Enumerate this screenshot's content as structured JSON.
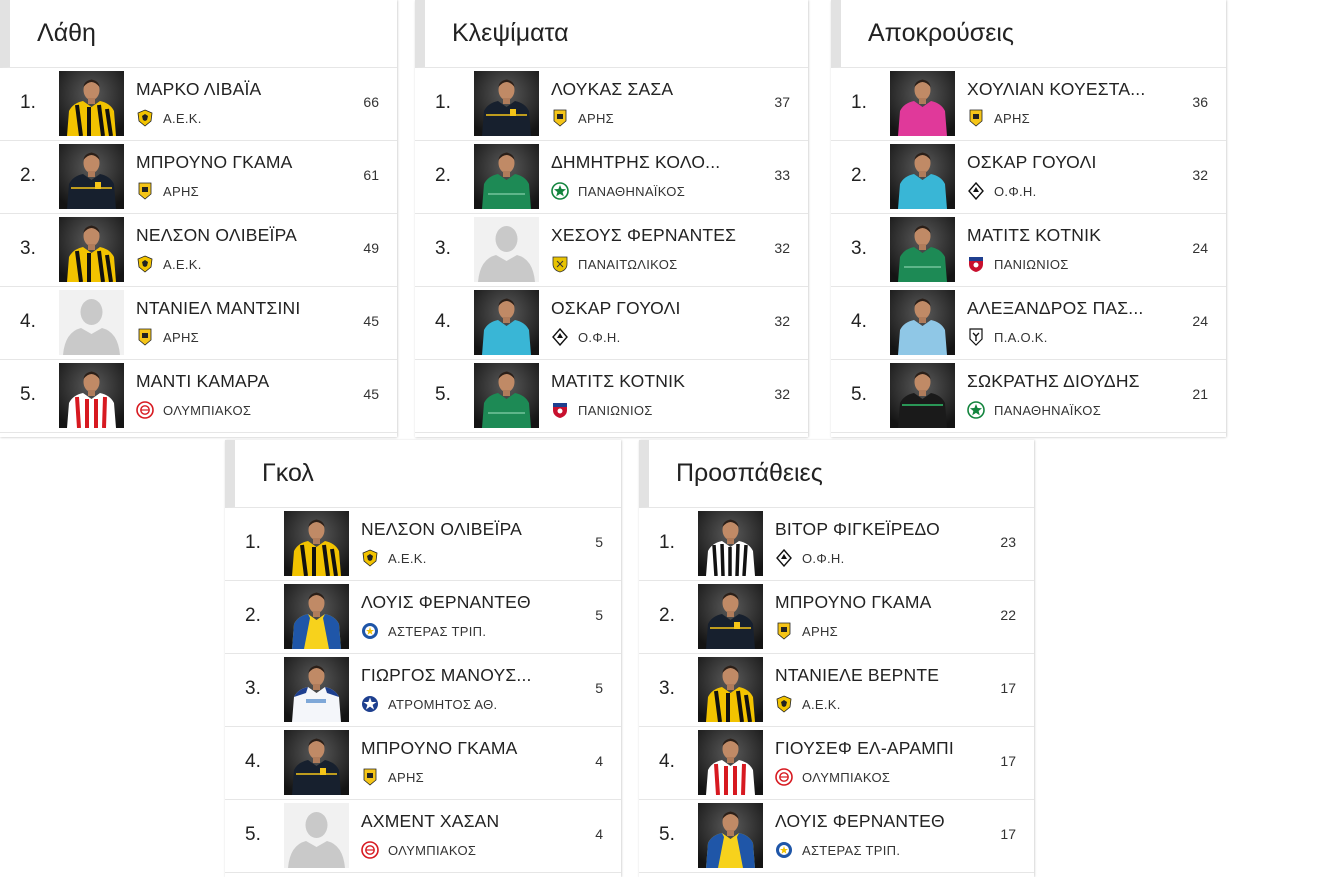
{
  "colors": {
    "header_bar": "#e2e2e2",
    "divider": "#e6e6e6",
    "aek": "#f2c300",
    "aris": "#f5c518",
    "olympiacos": "#d71920",
    "panathinaikos": "#12843d",
    "paniliakos": "#e8c300",
    "panionios": "#c8102e",
    "asteras": "#1f56a8",
    "atromitos": "#1d3f8f",
    "paok": "#111111",
    "ofi": "#111111"
  },
  "panels": [
    {
      "title": "Λάθη",
      "rows": [
        {
          "rank": "1.",
          "name": "ΜΑΡΚΟ ΛΙΒΑΪΑ",
          "team": "Α.Ε.Κ.",
          "crest": "aek-crest-icon",
          "photo": "aek",
          "value": "66"
        },
        {
          "rank": "2.",
          "name": "ΜΠΡΟΥΝΟ ΓΚΑΜΑ",
          "team": "ΑΡΗΣ",
          "crest": "aris-crest-icon",
          "photo": "aris",
          "value": "61"
        },
        {
          "rank": "3.",
          "name": "ΝΕΛΣΟΝ ΟΛΙΒΕΪΡΑ",
          "team": "Α.Ε.Κ.",
          "crest": "aek-crest-icon",
          "photo": "aek",
          "value": "49"
        },
        {
          "rank": "4.",
          "name": "ΝΤΑΝΙΕΛ ΜΑΝΤΣΙΝΙ",
          "team": "ΑΡΗΣ",
          "crest": "aris-crest-icon",
          "photo": "placeholder",
          "value": "45"
        },
        {
          "rank": "5.",
          "name": "ΜΑΝΤΙ ΚΑΜΑΡΑ",
          "team": "ΟΛΥΜΠΙΑΚΟΣ",
          "crest": "olympiacos-crest-icon",
          "photo": "olympiacos",
          "value": "45"
        }
      ]
    },
    {
      "title": "Κλεψίματα",
      "rows": [
        {
          "rank": "1.",
          "name": "ΛΟΥΚΑΣ ΣΑΣΑ",
          "team": "ΑΡΗΣ",
          "crest": "aris-crest-icon",
          "photo": "aris",
          "value": "37"
        },
        {
          "rank": "2.",
          "name": "ΔΗΜΗΤΡΗΣ ΚΟΛΟ...",
          "team": "ΠΑΝΑΘΗΝΑΪΚΟΣ",
          "crest": "panathinaikos-crest-icon",
          "photo": "pao",
          "value": "33"
        },
        {
          "rank": "3.",
          "name": "ΧΕΣΟΥΣ ΦΕΡΝΑΝΤΕΣ",
          "team": "ΠΑΝΑΙΤΩΛΙΚΟΣ",
          "crest": "panaitolikos-crest-icon",
          "photo": "placeholder",
          "value": "32"
        },
        {
          "rank": "4.",
          "name": "ΟΣΚΑΡ ΓΟΥΟΛΙ",
          "team": "Ο.Φ.Η.",
          "crest": "ofi-crest-icon",
          "photo": "gk-cyan",
          "value": "32"
        },
        {
          "rank": "5.",
          "name": "ΜΑΤΙΤΣ ΚΟΤΝΙΚ",
          "team": "ΠΑΝΙΩΝΙΟΣ",
          "crest": "panionios-crest-icon",
          "photo": "gk-green",
          "value": "32"
        }
      ]
    },
    {
      "title": "Αποκρούσεις",
      "rows": [
        {
          "rank": "1.",
          "name": "ΧΟΥΛΙΑΝ ΚΟΥΕΣΤΑ...",
          "team": "ΑΡΗΣ",
          "crest": "aris-crest-icon",
          "photo": "gk-pink",
          "value": "36"
        },
        {
          "rank": "2.",
          "name": "ΟΣΚΑΡ ΓΟΥΟΛΙ",
          "team": "Ο.Φ.Η.",
          "crest": "ofi-crest-icon",
          "photo": "gk-cyan",
          "value": "32"
        },
        {
          "rank": "3.",
          "name": "ΜΑΤΙΤΣ ΚΟΤΝΙΚ",
          "team": "ΠΑΝΙΩΝΙΟΣ",
          "crest": "panionios-crest-icon",
          "photo": "gk-green",
          "value": "24"
        },
        {
          "rank": "4.",
          "name": "ΑΛΕΞΑΝΔΡΟΣ ΠΑΣ...",
          "team": "Π.Α.Ο.Κ.",
          "crest": "paok-crest-icon",
          "photo": "gk-sky",
          "value": "24"
        },
        {
          "rank": "5.",
          "name": "ΣΩΚΡΑΤΗΣ ΔΙΟΥΔΗΣ",
          "team": "ΠΑΝΑΘΗΝΑΪΚΟΣ",
          "crest": "panathinaikos-crest-icon",
          "photo": "gk-black",
          "value": "21"
        }
      ]
    },
    {
      "title": "Γκολ",
      "rows": [
        {
          "rank": "1.",
          "name": "ΝΕΛΣΟΝ ΟΛΙΒΕΪΡΑ",
          "team": "Α.Ε.Κ.",
          "crest": "aek-crest-icon",
          "photo": "aek",
          "value": "5"
        },
        {
          "rank": "2.",
          "name": "ΛΟΥΙΣ ΦΕΡΝΑΝΤΕΘ",
          "team": "ΑΣΤΕΡΑΣ ΤΡΙΠ.",
          "crest": "asteras-crest-icon",
          "photo": "asteras",
          "value": "5"
        },
        {
          "rank": "3.",
          "name": "ΓΙΩΡΓΟΣ ΜΑΝΟΥΣ...",
          "team": "ΑΤΡΟΜΗΤΟΣ ΑΘ.",
          "crest": "atromitos-crest-icon",
          "photo": "atromitos",
          "value": "5"
        },
        {
          "rank": "4.",
          "name": "ΜΠΡΟΥΝΟ ΓΚΑΜΑ",
          "team": "ΑΡΗΣ",
          "crest": "aris-crest-icon",
          "photo": "aris",
          "value": "4"
        },
        {
          "rank": "5.",
          "name": "ΑΧΜΕΝΤ ΧΑΣΑΝ",
          "team": "ΟΛΥΜΠΙΑΚΟΣ",
          "crest": "olympiacos-crest-icon",
          "photo": "placeholder",
          "value": "4"
        }
      ]
    },
    {
      "title": "Προσπάθειες",
      "rows": [
        {
          "rank": "1.",
          "name": "ΒΙΤΟΡ ΦΙΓΚΕΪΡΕΔΟ",
          "team": "Ο.Φ.Η.",
          "crest": "ofi-crest-icon",
          "photo": "ofi",
          "value": "23"
        },
        {
          "rank": "2.",
          "name": "ΜΠΡΟΥΝΟ ΓΚΑΜΑ",
          "team": "ΑΡΗΣ",
          "crest": "aris-crest-icon",
          "photo": "aris",
          "value": "22"
        },
        {
          "rank": "3.",
          "name": "ΝΤΑΝΙΕΛΕ ΒΕΡΝΤΕ",
          "team": "Α.Ε.Κ.",
          "crest": "aek-crest-icon",
          "photo": "aek",
          "value": "17"
        },
        {
          "rank": "4.",
          "name": "ΓΙΟΥΣΕΦ ΕΛ-ΑΡΑΜΠΙ",
          "team": "ΟΛΥΜΠΙΑΚΟΣ",
          "crest": "olympiacos-crest-icon",
          "photo": "olympiacos",
          "value": "17"
        },
        {
          "rank": "5.",
          "name": "ΛΟΥΙΣ ΦΕΡΝΑΝΤΕΘ",
          "team": "ΑΣΤΕΡΑΣ ΤΡΙΠ.",
          "crest": "asteras-crest-icon",
          "photo": "asteras",
          "value": "17"
        }
      ]
    }
  ]
}
